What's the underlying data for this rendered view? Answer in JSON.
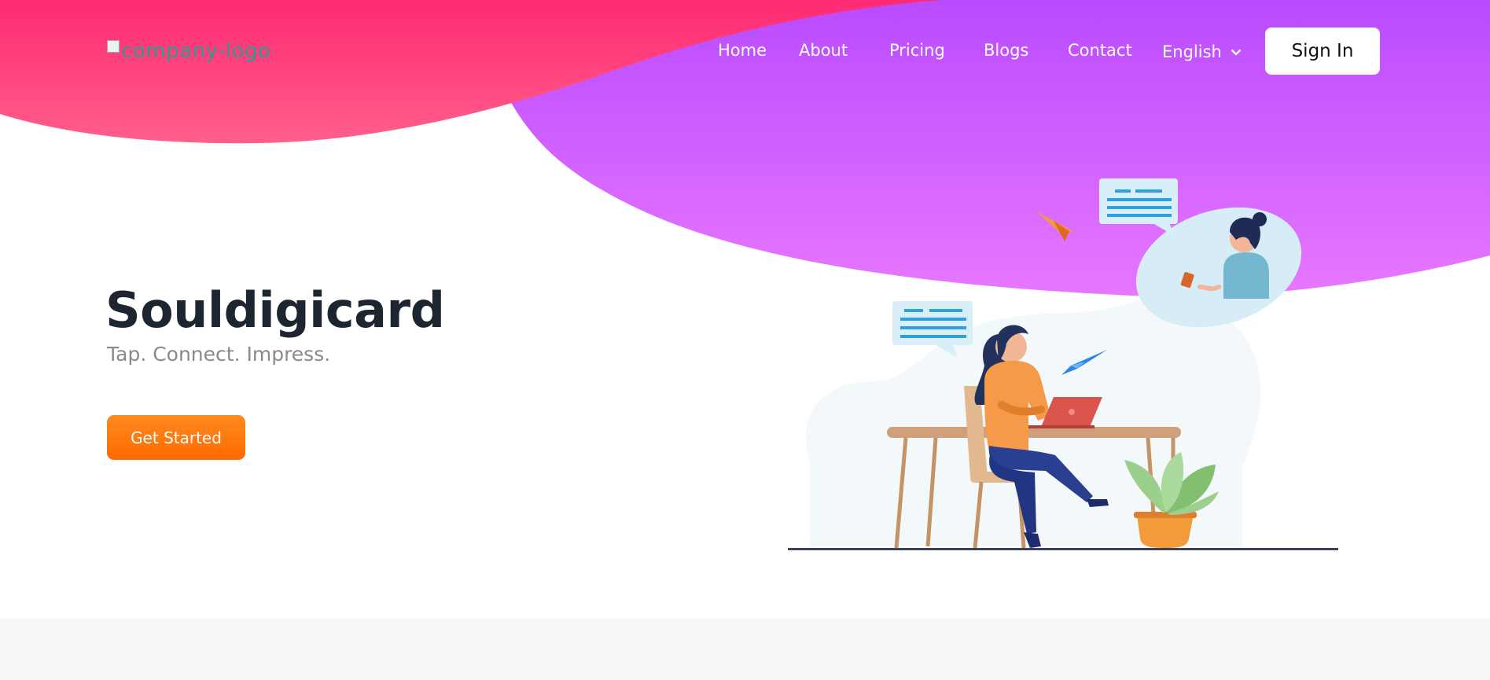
{
  "header": {
    "logo_alt": "company-logo",
    "nav": [
      {
        "label": "Home"
      },
      {
        "label": "About"
      },
      {
        "label": "Pricing"
      },
      {
        "label": "Blogs"
      },
      {
        "label": "Contact"
      }
    ],
    "language": "English",
    "sign_in_label": "Sign In"
  },
  "hero": {
    "title": "Souldigicard",
    "tagline": "Tap. Connect. Impress.",
    "cta_label": "Get Started"
  },
  "colors": {
    "blob_pink": "#ff2d78",
    "blob_purple": "#c050ff",
    "cta_orange": "#ff7a10",
    "title_dark": "#1d2530"
  },
  "icons": {
    "language_dropdown": "chevron-down-icon",
    "logo": "broken-image-icon"
  }
}
